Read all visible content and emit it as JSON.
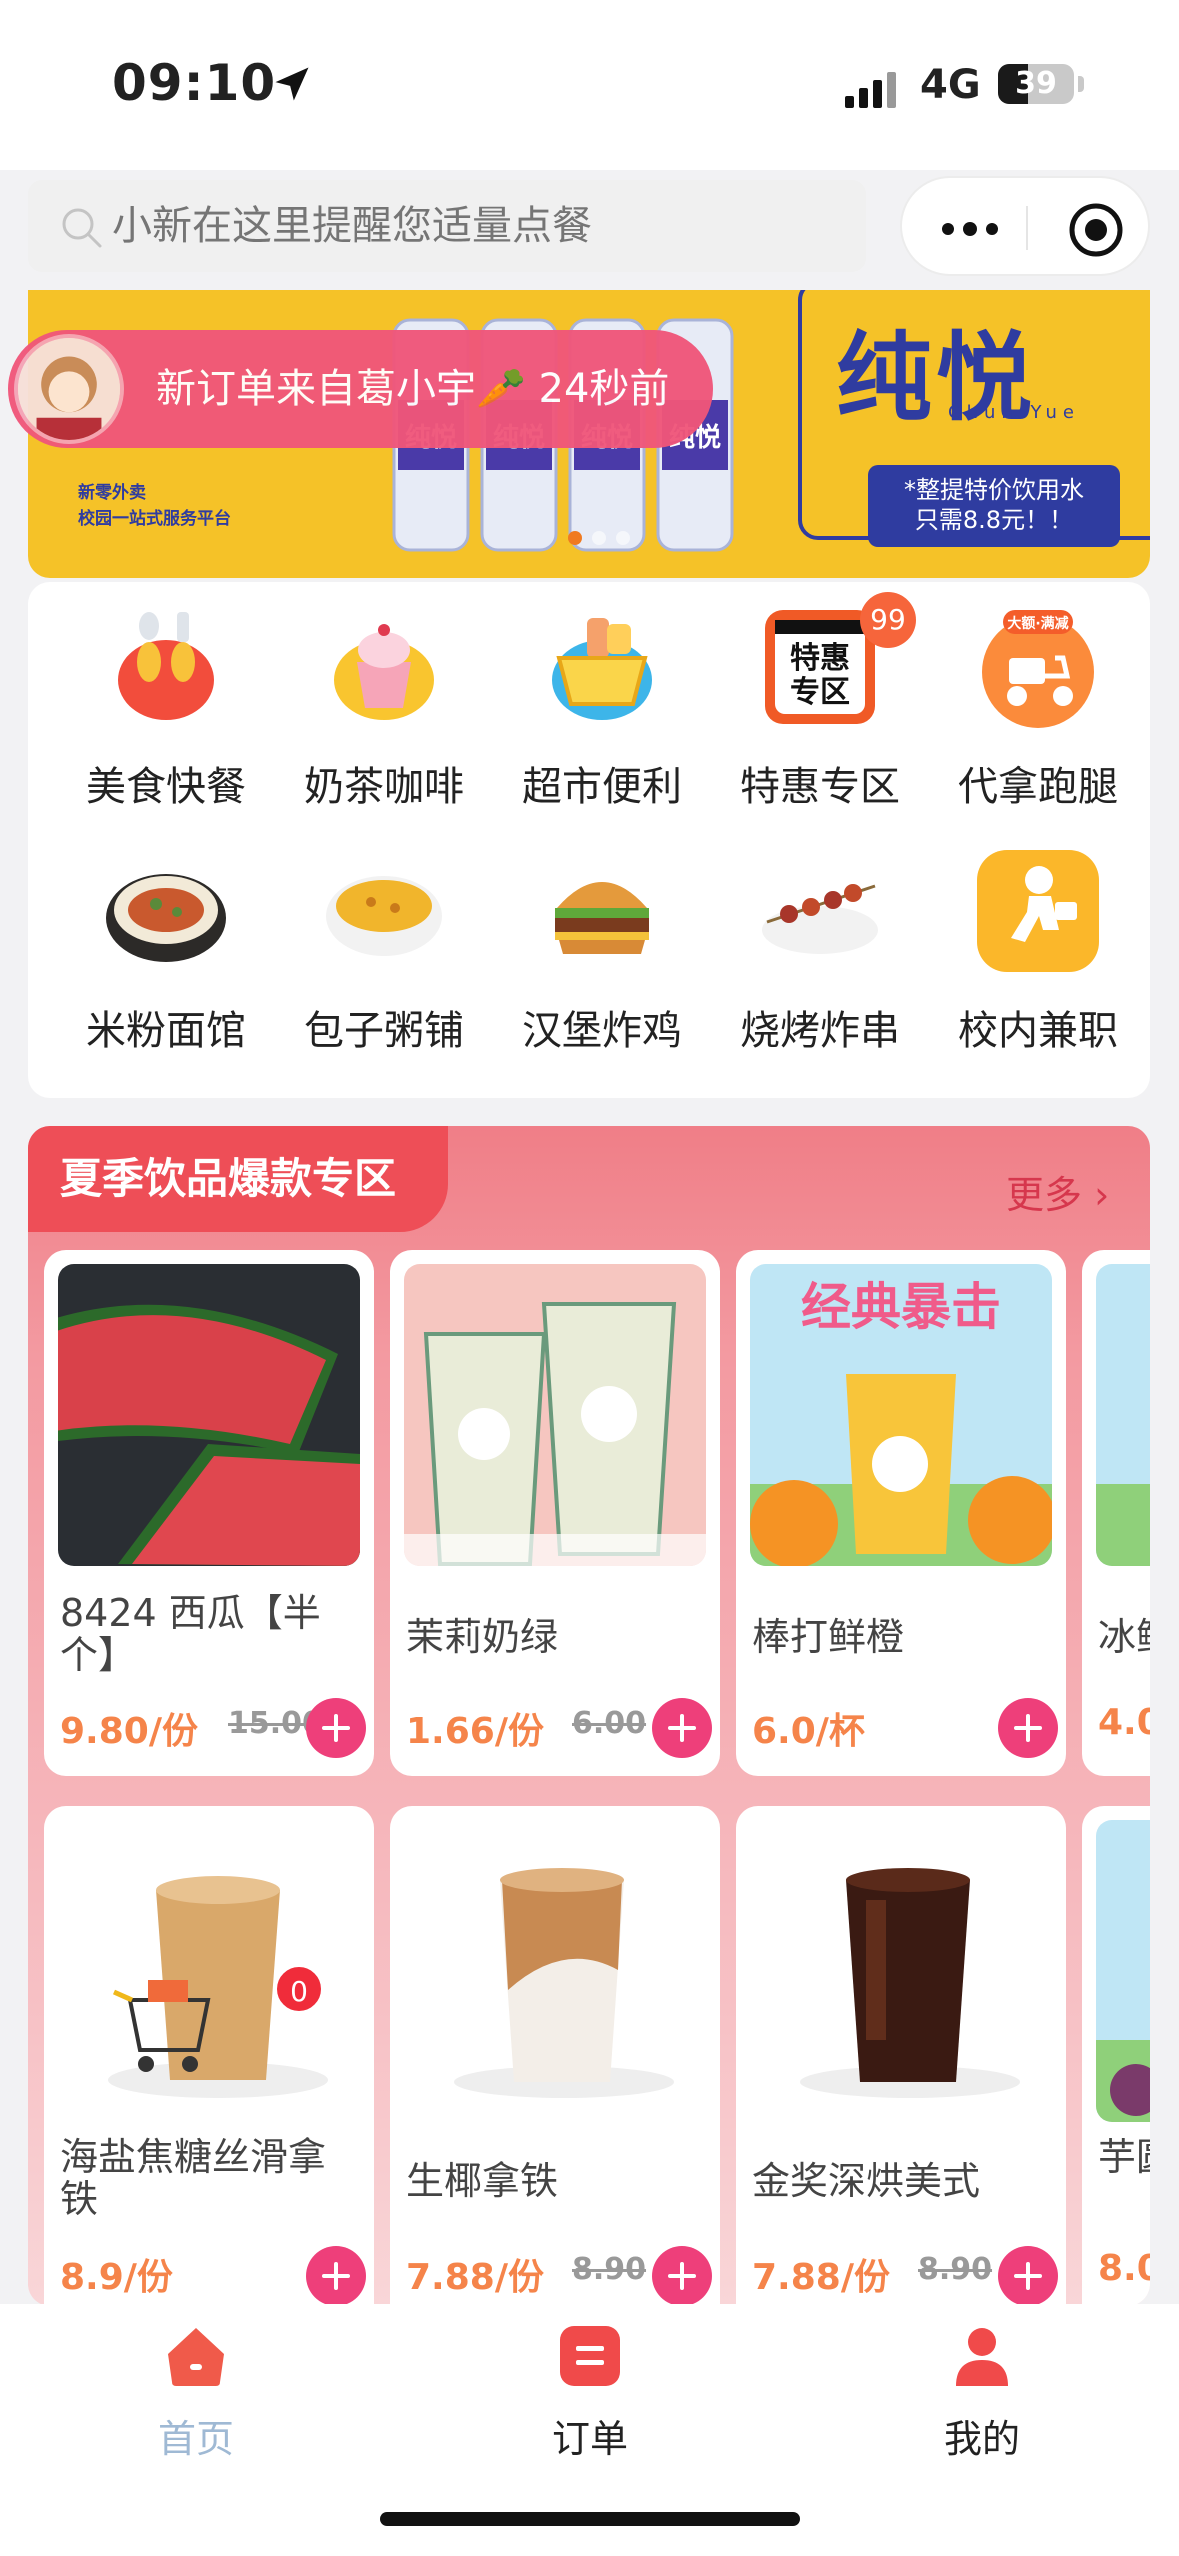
{
  "status_bar": {
    "time": "09:10",
    "network": "4G",
    "battery": "39",
    "battery_level": 0.39
  },
  "search": {
    "placeholder": "小新在这里提醒您适量点餐"
  },
  "banner": {
    "brand": "纯悦",
    "brand_sub": "Chun Yue",
    "promo_line1": "*整提特价饮用水",
    "promo_line2": "只需8.8元！！",
    "slogan_line1": "新零外卖",
    "slogan_line2": "校园一站式服务平台",
    "bottle_label": "纯悦"
  },
  "order_notice": {
    "text": "新订单来自葛小宇🥕 24秒前"
  },
  "categories": [
    {
      "label": "美食快餐",
      "icon": "fork-spoon-icon"
    },
    {
      "label": "奶茶咖啡",
      "icon": "ice-cream-cup-icon"
    },
    {
      "label": "超市便利",
      "icon": "shopping-basket-icon"
    },
    {
      "label": "特惠专区",
      "icon": "special-offer-icon",
      "badge": "99",
      "icon_text": "特惠专区"
    },
    {
      "label": "代拿跑腿",
      "icon": "scooter-icon",
      "icon_text": "大额·满减"
    },
    {
      "label": "米粉面馆",
      "icon": "noodle-bowl-icon"
    },
    {
      "label": "包子粥铺",
      "icon": "porridge-bowl-icon"
    },
    {
      "label": "汉堡炸鸡",
      "icon": "burger-icon"
    },
    {
      "label": "烧烤炸串",
      "icon": "skewer-icon"
    },
    {
      "label": "校内兼职",
      "icon": "running-courier-icon"
    }
  ],
  "promo_section": {
    "title": "夏季饮品爆款专区",
    "more": "更多",
    "row1": [
      {
        "name": "8424 西瓜【半个】",
        "price": "9.80/份",
        "orig": "15.00",
        "image": "watermelon"
      },
      {
        "name": "茉莉奶绿",
        "price": "1.66/份",
        "orig": "6.00",
        "image": "jasmine-milk-tea"
      },
      {
        "name": "棒打鲜橙",
        "price": "6.0/杯",
        "orig": "",
        "image": "orange-drink",
        "poster_text": "经典暴击"
      },
      {
        "name": "冰鲜",
        "price": "4.0",
        "orig": "",
        "image": "partial"
      }
    ],
    "row2": [
      {
        "name": "海盐焦糖丝滑拿铁",
        "price": "8.9/份",
        "orig": "",
        "image": "caramel-latte"
      },
      {
        "name": "生椰拿铁",
        "price": "7.88/份",
        "orig": "8.90",
        "image": "coconut-latte"
      },
      {
        "name": "金奖深烘美式",
        "price": "7.88/份",
        "orig": "8.90",
        "image": "americano"
      },
      {
        "name": "芋圆版)",
        "price": "8.0",
        "orig": "",
        "image": "partial"
      }
    ],
    "cart_count": "0"
  },
  "tabbar": [
    {
      "label": "首页",
      "icon": "home-icon",
      "active": true
    },
    {
      "label": "订单",
      "icon": "order-icon",
      "active": false
    },
    {
      "label": "我的",
      "icon": "user-icon",
      "active": false
    }
  ],
  "colors": {
    "accent": "#ee3f7a",
    "price": "#f5844a",
    "section": "#ee4e57",
    "banner": "#f5c228"
  }
}
